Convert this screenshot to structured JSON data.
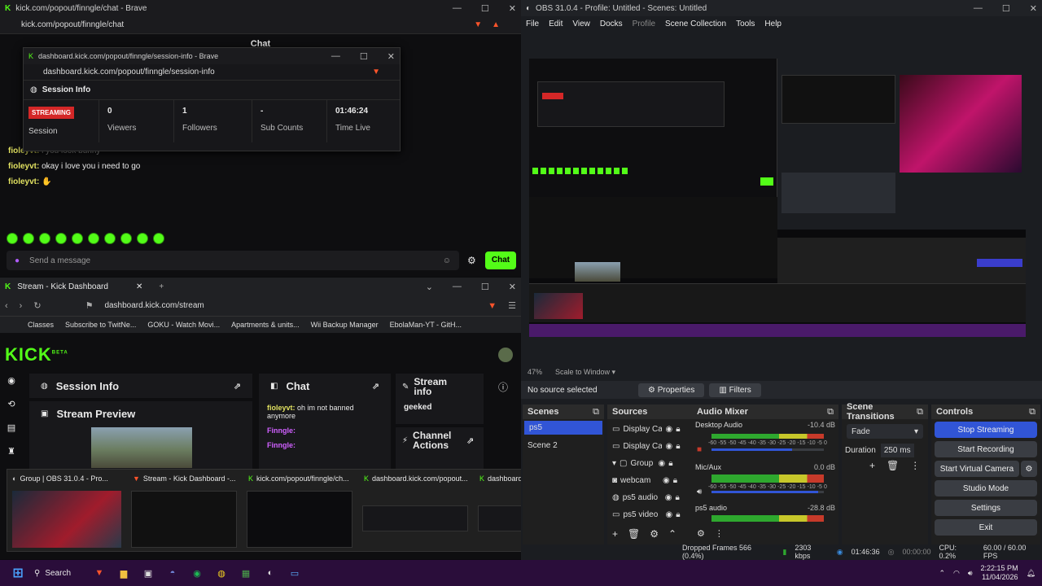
{
  "chat_window": {
    "title": "kick.com/popout/finngle/chat - Brave",
    "url": "kick.com/popout/finngle/chat",
    "heading": "Chat",
    "messages": [
      {
        "user": "fioleyvt:",
        "text": "i you look bunny"
      },
      {
        "user": "fioleyvt:",
        "text": "okay i love you i need to go"
      },
      {
        "user": "fioleyvt:",
        "text": ""
      }
    ],
    "input_placeholder": "Send a message",
    "send_label": "Chat"
  },
  "session_popup": {
    "title": "dashboard.kick.com/popout/finngle/session-info - Brave",
    "url": "dashboard.kick.com/popout/finngle/session-info",
    "heading": "Session Info",
    "status_badge": "STREAMING",
    "status_caption": "Session",
    "stats": [
      {
        "value": "0",
        "label": "Viewers"
      },
      {
        "value": "1",
        "label": "Followers"
      },
      {
        "value": "-",
        "label": "Sub Counts"
      },
      {
        "value": "01:46:24",
        "label": "Time Live"
      }
    ]
  },
  "dashboard_window": {
    "tab_title": "Stream - Kick Dashboard",
    "url": "dashboard.kick.com/stream",
    "bookmarks": [
      "Classes",
      "Subscribe to TwitNe...",
      "GOKU - Watch Movi...",
      "Apartments & units...",
      "Wii Backup Manager",
      "EbolaMan-YT - GitH..."
    ],
    "logo": "KICK",
    "logo_beta": "BETA",
    "session_info": "Session Info",
    "stream_preview": "Stream Preview",
    "chat": "Chat",
    "chat_msg_user": "fioleyvt:",
    "chat_msg_text": "oh im not banned anymore",
    "chat_user2": "Finngle:",
    "chat_user3": "Finngle:",
    "stream_info": "Stream info",
    "stream_info_value": "geeked",
    "channel_actions": "Channel Actions"
  },
  "taskbar_preview": {
    "items": [
      "Group | OBS 31.0.4 - Pro...",
      "Stream - Kick Dashboard -...",
      "kick.com/popout/finngle/ch...",
      "dashboard.kick.com/popout...",
      "dashboard.kick.com/popout..."
    ]
  },
  "obs": {
    "title": "OBS 31.0.4 - Profile: Untitled - Scenes: Untitled",
    "menu": [
      "File",
      "Edit",
      "View",
      "Docks",
      "Profile",
      "Scene Collection",
      "Tools",
      "Help"
    ],
    "zoom": "47%",
    "scale_label": "Scale to Window",
    "no_source": "No source selected",
    "properties": "Properties",
    "filters": "Filters",
    "scenes_title": "Scenes",
    "scenes": [
      "ps5",
      "Scene 2"
    ],
    "sources_title": "Sources",
    "sources": [
      "Display Cap",
      "Display Cap",
      "Group",
      "webcam",
      "ps5 audio",
      "ps5 video"
    ],
    "mixer_title": "Audio Mixer",
    "mixer": [
      {
        "name": "Desktop Audio",
        "db": "-10.4 dB",
        "level": 0.72
      },
      {
        "name": "Mic/Aux",
        "db": "0.0 dB",
        "level": 0.95
      },
      {
        "name": "ps5 audio",
        "db": "-28.8 dB",
        "level": 0.6
      }
    ],
    "meter_scale": [
      "-60",
      "-55",
      "-50",
      "-45",
      "-40",
      "-35",
      "-30",
      "-25",
      "-20",
      "-15",
      "-10",
      "-5",
      "0"
    ],
    "transitions_title": "Scene Transitions",
    "transition": "Fade",
    "duration_label": "Duration",
    "duration_value": "250 ms",
    "controls_title": "Controls",
    "controls": [
      "Stop Streaming",
      "Start Recording",
      "Start Virtual Camera",
      "Studio Mode",
      "Settings",
      "Exit"
    ],
    "status": {
      "dropped": "Dropped Frames 566 (0.4%)",
      "kbps": "2303 kbps",
      "live_time": "01:46:36",
      "rec_time": "00:00:00",
      "cpu": "CPU: 0.2%",
      "fps": "60.00 / 60.00 FPS"
    }
  },
  "taskbar": {
    "search": "Search",
    "time": "2:22:15 PM",
    "date": "11/04/2026"
  }
}
